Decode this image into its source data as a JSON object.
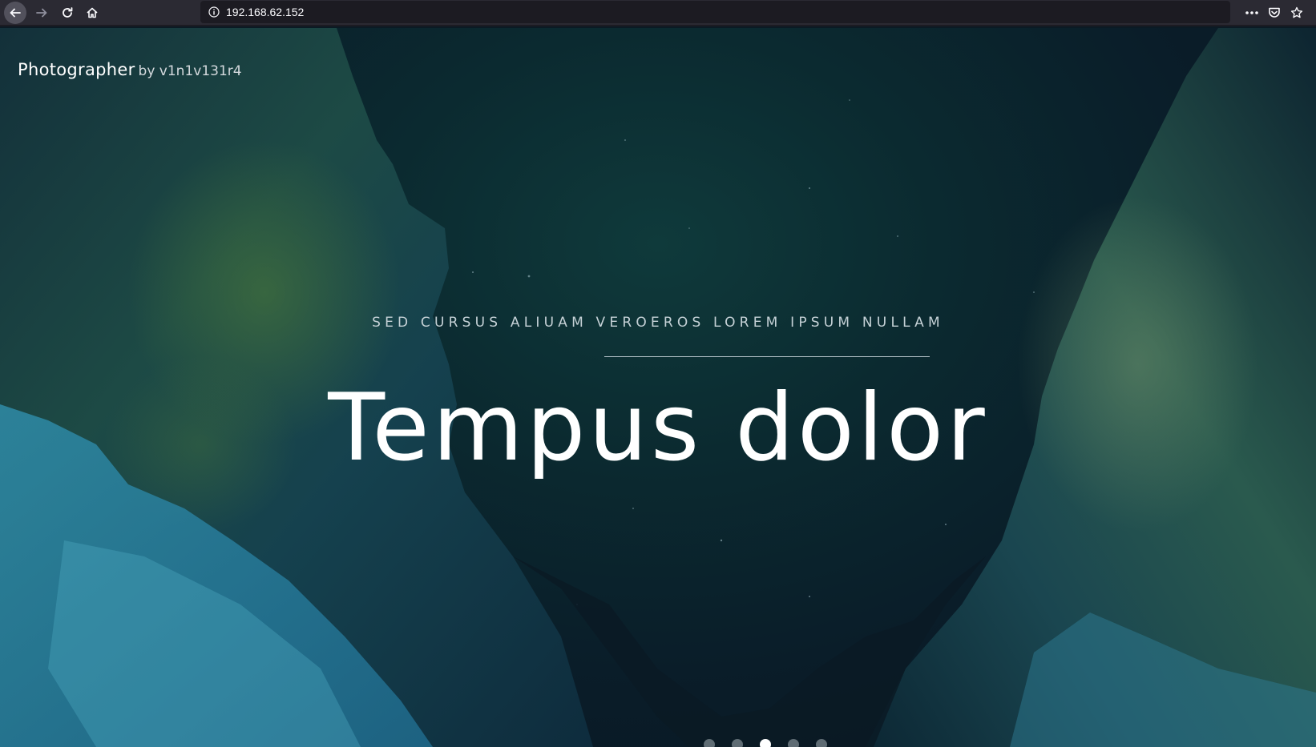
{
  "browser": {
    "url": "192.168.62.152",
    "icons": [
      "back-arrow-icon",
      "forward-arrow-icon",
      "reload-icon",
      "home-icon",
      "info-icon",
      "more-icon",
      "pocket-icon",
      "bookmark-star-icon"
    ]
  },
  "site": {
    "brand_name": "Photographer",
    "brand_by": "by v1n1v131r4"
  },
  "hero": {
    "subtitle": "SED CURSUS ALIUAM VEROEROS LOREM IPSUM NULLAM",
    "title": "Tempus dolor"
  },
  "slider": {
    "total_slides": 5,
    "active_slide": 3
  },
  "colors": {
    "toolbar_bg": "#2b2a33",
    "urlbar_bg": "#1c1b22",
    "page_bg": "#0b1a24",
    "text_primary": "#ffffff"
  }
}
